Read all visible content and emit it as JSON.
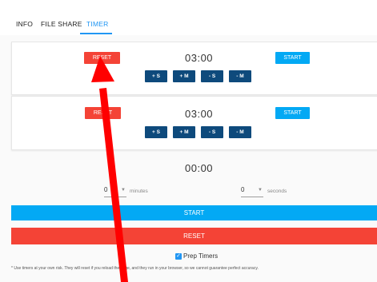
{
  "tabs": [
    {
      "label": "INFO",
      "active": false
    },
    {
      "label": "FILE SHARE",
      "active": false
    },
    {
      "label": "TIMER",
      "active": true
    }
  ],
  "timers": [
    {
      "reset_label": "RESET",
      "time": "03:00",
      "start_label": "START",
      "adjust": [
        "+ S",
        "+ M",
        "- S",
        "- M"
      ]
    },
    {
      "reset_label": "RESET",
      "time": "03:00",
      "start_label": "START",
      "adjust": [
        "+ S",
        "+ M",
        "- S",
        "- M"
      ]
    }
  ],
  "prep": {
    "time": "00:00",
    "minutes_value": "0",
    "minutes_label": "minutes",
    "seconds_value": "0",
    "seconds_label": "seconds",
    "start_label": "START",
    "reset_label": "RESET",
    "checkbox_label": "Prep Timers",
    "checkbox_checked": true
  },
  "disclaimer": "* Use timers at your own risk. They will reset if you reload the page, and they run in your browser, so we cannot guarantee perfect accuracy.",
  "colors": {
    "accent": "#2196f3",
    "start": "#03a9f4",
    "reset": "#f44336",
    "adjust": "#0e4a7c",
    "annotation_arrow": "#ff0000"
  }
}
